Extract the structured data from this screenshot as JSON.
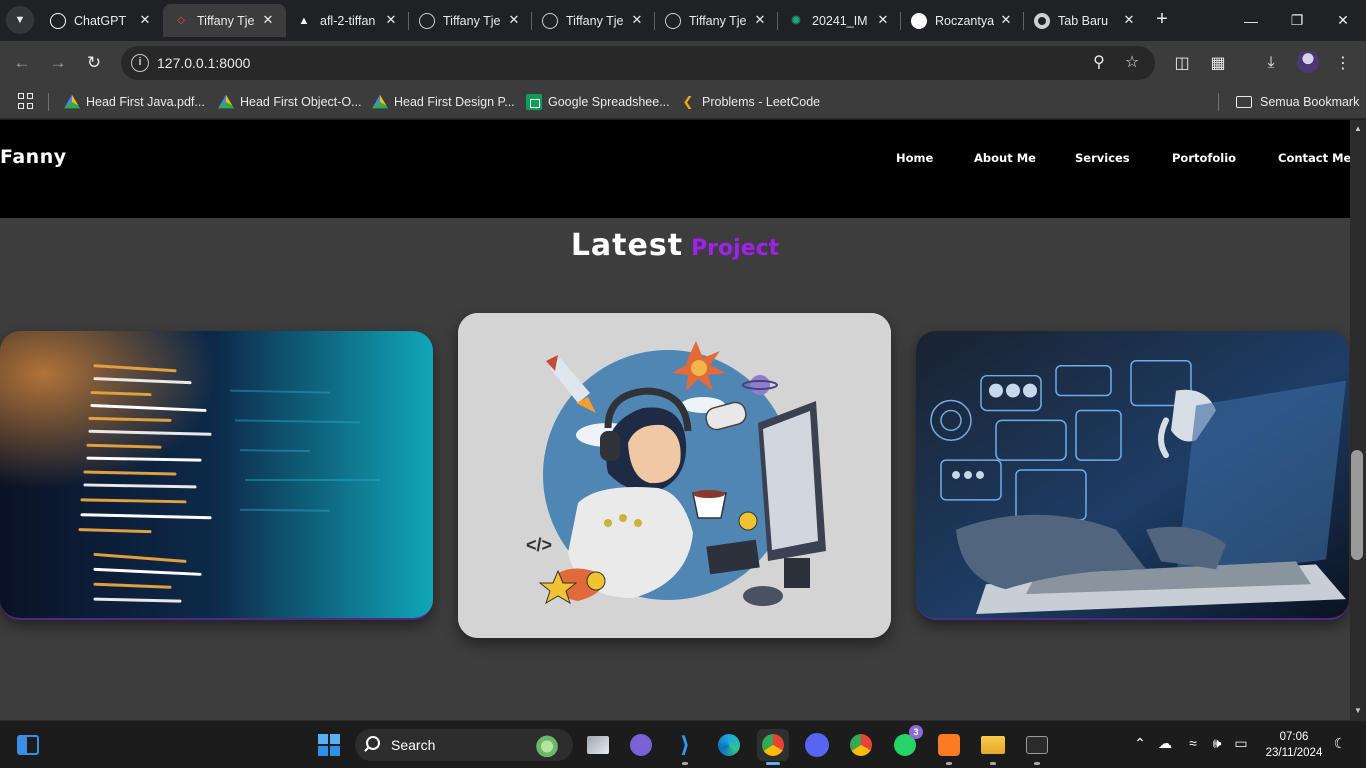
{
  "browser": {
    "tabs": [
      {
        "title": "ChatGPT",
        "icon": "chatgpt-icon",
        "color": "#ffffff"
      },
      {
        "title": "Tiffany Tje",
        "icon": "laravel-icon",
        "color": "#f05340"
      },
      {
        "title": "afl-2-tiffan",
        "icon": "vercel-icon",
        "color": "#ffffff"
      },
      {
        "title": "Tiffany Tje",
        "icon": "globe-icon",
        "color": "#cfcfcf"
      },
      {
        "title": "Tiffany Tje",
        "icon": "globe-icon",
        "color": "#cfcfcf"
      },
      {
        "title": "Tiffany Tje",
        "icon": "globe-icon",
        "color": "#cfcfcf"
      },
      {
        "title": "20241_IM",
        "icon": "edlink-icon",
        "color": "#1aa37a"
      },
      {
        "title": "Roczantya",
        "icon": "github-icon",
        "color": "#ffffff"
      },
      {
        "title": "Tab Baru",
        "icon": "chrome-icon",
        "color": "#cfcfcf"
      }
    ],
    "active_tab": 1,
    "address": "127.0.0.1:8000",
    "bookmarks": [
      {
        "label": "Head First Java.pdf...",
        "icon": "drive-icon"
      },
      {
        "label": "Head First Object-O...",
        "icon": "drive-icon"
      },
      {
        "label": "Head First Design P...",
        "icon": "drive-icon"
      },
      {
        "label": "Google Spreadshee...",
        "icon": "sheets-icon"
      },
      {
        "label": "Problems - LeetCode",
        "icon": "leetcode-icon"
      }
    ],
    "bookmarks_folder": "Semua Bookmark"
  },
  "site": {
    "logo": "Fanny",
    "nav": [
      "Home",
      "About Me",
      "Services",
      "Portofolio",
      "Contact Me"
    ],
    "section_title_white": "Latest",
    "section_title_purple": "Project",
    "accent_color": "#a020f0",
    "cards": [
      {
        "name": "code-screen-image"
      },
      {
        "name": "developer-illustration-image"
      },
      {
        "name": "laptop-ai-image"
      }
    ]
  },
  "taskbar": {
    "search_label": "Search",
    "whatsapp_badge": "3",
    "time": "07:06",
    "date": "23/11/2024"
  }
}
